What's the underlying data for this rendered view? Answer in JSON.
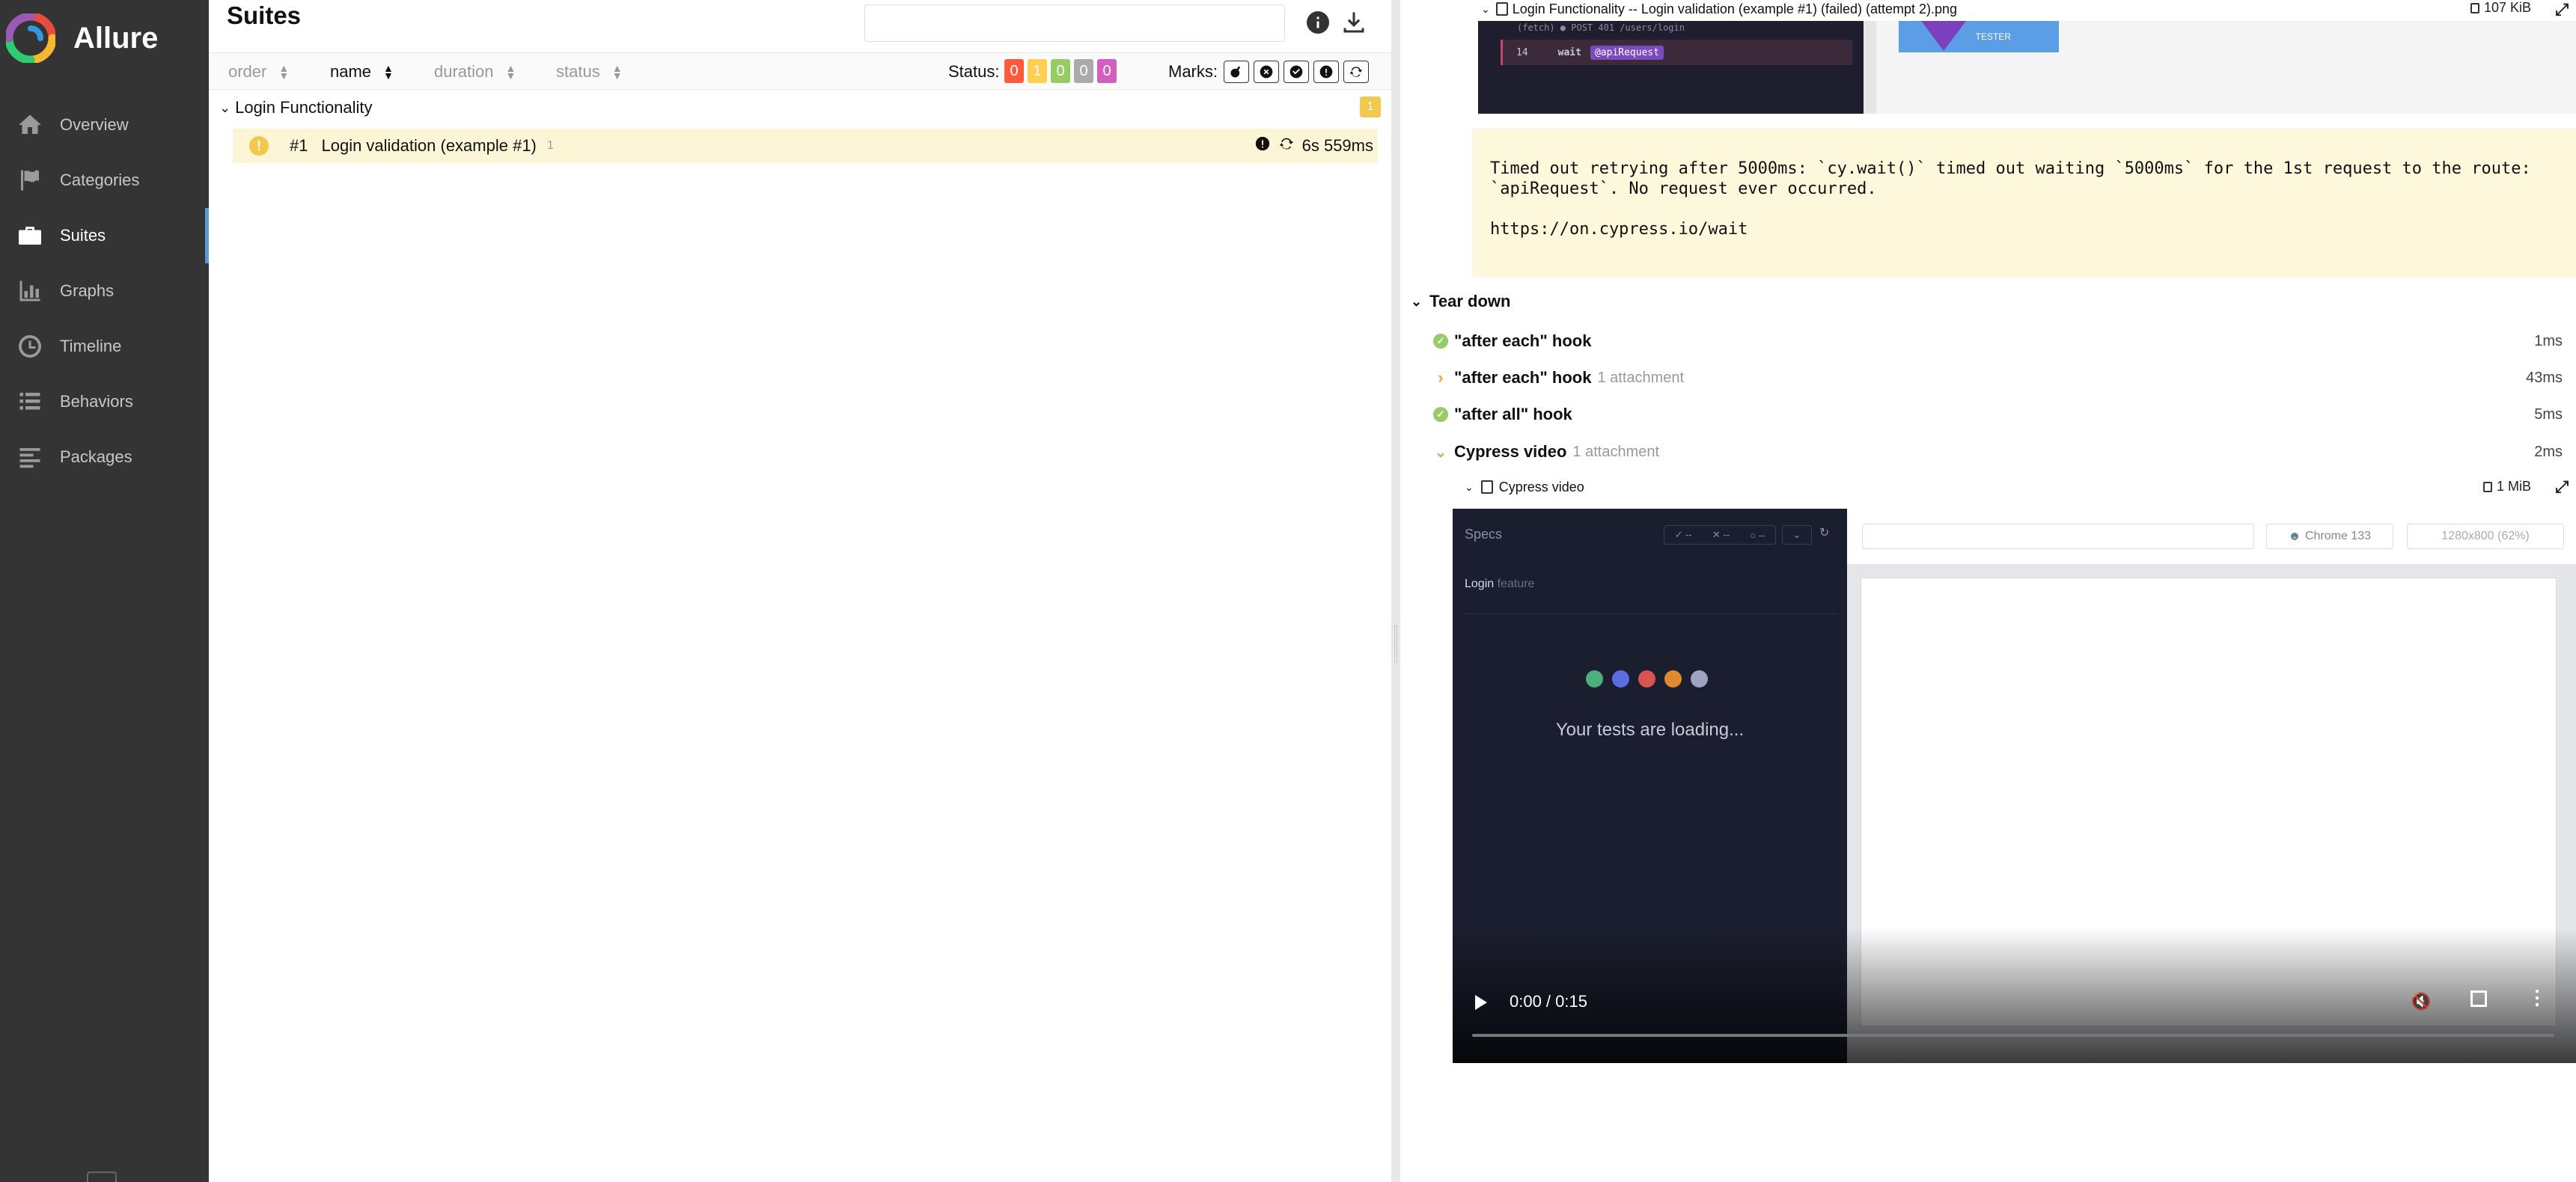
{
  "app": {
    "name": "Allure"
  },
  "sidebar": {
    "items": [
      {
        "label": "Overview",
        "icon": "home-icon"
      },
      {
        "label": "Categories",
        "icon": "flag-icon"
      },
      {
        "label": "Suites",
        "icon": "briefcase-icon",
        "active": true
      },
      {
        "label": "Graphs",
        "icon": "bar-chart-icon"
      },
      {
        "label": "Timeline",
        "icon": "clock-icon"
      },
      {
        "label": "Behaviors",
        "icon": "list-icon"
      },
      {
        "label": "Packages",
        "icon": "align-left-icon"
      }
    ]
  },
  "suites": {
    "title": "Suites",
    "sort": {
      "order": "order",
      "name": "name",
      "duration": "duration",
      "status": "status"
    },
    "status_label": "Status:",
    "status_counts": [
      {
        "value": "0",
        "color": "#fd5a3e"
      },
      {
        "value": "1",
        "color": "#ffd050"
      },
      {
        "value": "0",
        "color": "#97cc64"
      },
      {
        "value": "0",
        "color": "#aaaaaa"
      },
      {
        "value": "0",
        "color": "#d35ebe"
      }
    ],
    "marks_label": "Marks:",
    "group": {
      "name": "Login Functionality",
      "count": "1"
    },
    "test": {
      "order": "#1",
      "name": "Login validation (example #1)",
      "retries": "1",
      "duration": "6s 559ms"
    }
  },
  "result": {
    "screenshot_attachment": {
      "name": "Login Functionality -- Login validation (example #1) (failed) (attempt 2).png",
      "size": "107 KiB"
    },
    "screenshot_preview": {
      "line_top": "(fetch)  ● POST 401 /users/login",
      "line_no": "14",
      "command": "wait",
      "alias": "@apiRequest",
      "banner_text": "TESTER"
    },
    "error_message": "Timed out retrying after 5000ms: `cy.wait()` timed out waiting `5000ms` for the 1st request to the route:\n`apiRequest`. No request ever occurred.\n\nhttps://on.cypress.io/wait",
    "teardown": {
      "title": "Tear down",
      "steps": [
        {
          "name": "\"after each\" hook",
          "attachments": "",
          "duration": "1ms",
          "state": "passed"
        },
        {
          "name": "\"after each\" hook",
          "attachments": "1 attachment",
          "duration": "43ms",
          "state": "collapsed"
        },
        {
          "name": "\"after all\" hook",
          "attachments": "",
          "duration": "5ms",
          "state": "passed"
        },
        {
          "name": "Cypress video",
          "attachments": "1 attachment",
          "duration": "2ms",
          "state": "expanded"
        }
      ]
    },
    "video_attachment": {
      "name": "Cypress video",
      "size": "1 MiB"
    },
    "video": {
      "specs_label": "Specs",
      "spec_name": "Login",
      "spec_suffix": "feature",
      "loading_text": "Your tests are loading...",
      "browser": "Chrome 133",
      "viewport": "1280x800 (62%)",
      "time": "0:00 / 0:15",
      "dot_colors": [
        "#4caf7d",
        "#5b6ee1",
        "#d9534f",
        "#e08a2e",
        "#9fa3c0"
      ]
    }
  }
}
